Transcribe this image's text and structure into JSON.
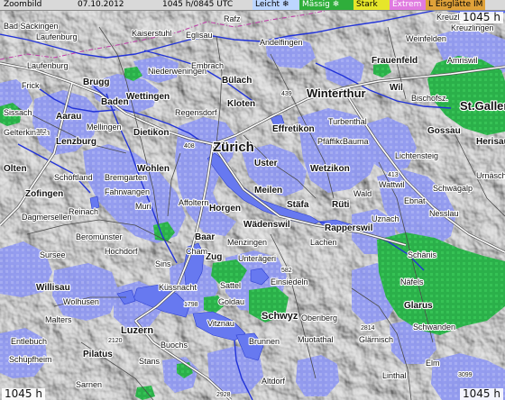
{
  "header": {
    "title": "Zoombild",
    "date": "07.10.2012",
    "time": "1045 h/0845 UTC"
  },
  "legend": [
    {
      "label": "Leicht",
      "symbol": "❄",
      "bg": "#bcd6ff",
      "color": "#000000"
    },
    {
      "label": "Mässig",
      "symbol": "❄",
      "bg": "#2fae3b",
      "color": "#ffffff"
    },
    {
      "label": "Stark",
      "symbol": "",
      "bg": "#e6e62a",
      "color": "#000000"
    },
    {
      "label": "Extrem",
      "symbol": "",
      "bg": "#e07be0",
      "color": "#ffffff"
    },
    {
      "label": "L Eisglätte",
      "symbol": "IM",
      "bg": "#e0a23a",
      "color": "#000000"
    }
  ],
  "corners": {
    "top_right": "1045 h",
    "bottom_left": "1045 h",
    "bottom_right": "1045 h"
  },
  "colors": {
    "relief": "#bdbdbd",
    "lake": "#6b7df0",
    "light_precip": "#9aa3f5",
    "moderate_precip": "#2bb34a",
    "road": "#ffffff"
  },
  "towns": [
    "Bad Säckingen",
    "Laufenburg",
    "Laufenburg",
    "Frick",
    "Brugg",
    "Baden",
    "Wettingen",
    "Niederweningen",
    "Bülach",
    "Kloten",
    "Dietikon",
    "Zürich",
    "Effretikon",
    "Winterthur",
    "Frauenfeld",
    "Turbenthal",
    "Pfäffikon",
    "Bauma",
    "Wetzikon",
    "Uster",
    "Aarau",
    "Lenzburg",
    "Wohlen",
    "Olten",
    "Zofingen",
    "Reinach",
    "Muri",
    "Affoltern",
    "Horgen",
    "Meilen",
    "Stäfa",
    "Rüti",
    "Wald",
    "Rapperswil",
    "Wädenswil",
    "Baar",
    "Zug",
    "Unterägeri",
    "Einsiedeln",
    "Lachen",
    "Sursee",
    "Willisau",
    "Wolhusen",
    "Malters",
    "Luzern",
    "Küssnacht",
    "Sattel",
    "Goldau",
    "Schwyz",
    "Oberiberg",
    "Vitznau",
    "Brunnen",
    "Muotathal",
    "Glarus",
    "Näfels",
    "Glärnisch",
    "Gossau",
    "St.Gallen",
    "Herisau",
    "Wil",
    "Bischofsz.",
    "Amriswil",
    "Weinfelden",
    "Kreuzl.",
    "Lichtensteig",
    "Wattwil",
    "Nesslau",
    "Schwägalp",
    "Urnäsch",
    "Ebnat",
    "Entlebuch",
    "Schüpfheim",
    "Pilatus",
    "Buochs",
    "Sarnen",
    "Altdorf",
    "Linthal",
    "Stans",
    "Hochdorf",
    "Sins",
    "Cham",
    "Menzingen",
    "Uznach",
    "Schänis",
    "Dagmersellen",
    "Schöftland",
    "Beromünster",
    "Fahrwangen",
    "Regensdorf",
    "Embrach",
    "Andelfingen",
    "Eglisau",
    "Rafz",
    "Kaiserstuhl",
    "Bremgarten",
    "Mellingen",
    "Gelterkinden",
    "Sissach",
    "Kreuzlingen",
    "Elm",
    "Schwanden"
  ],
  "road_numbers": [
    "382",
    "439",
    "408",
    "2120",
    "1798",
    "2814",
    "2928",
    "3099",
    "582",
    "413"
  ]
}
